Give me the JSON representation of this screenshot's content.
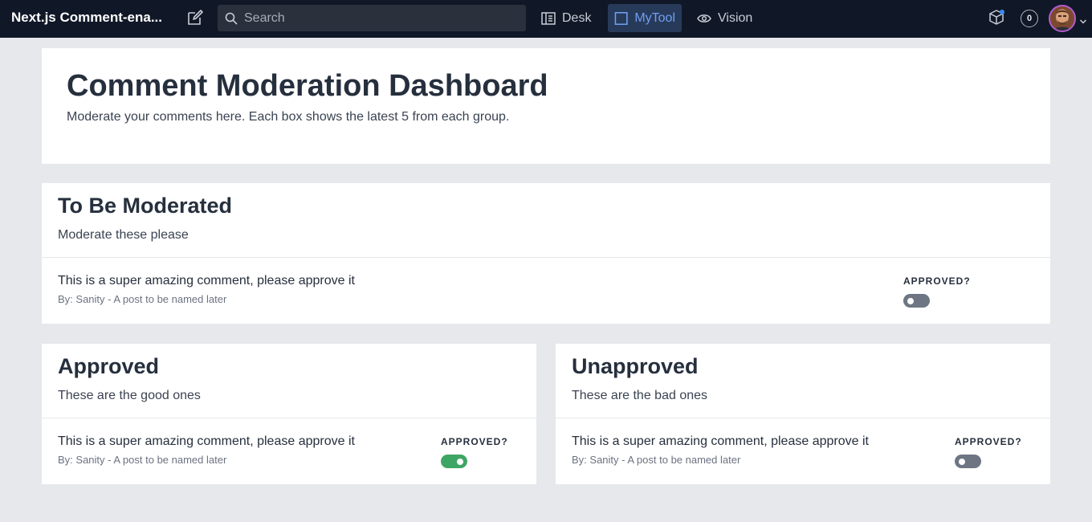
{
  "navbar": {
    "brand": "Next.js Comment-ena...",
    "search_placeholder": "Search",
    "tabs": [
      {
        "label": "Desk",
        "icon": "desk-icon"
      },
      {
        "label": "MyTool",
        "icon": "square-icon"
      },
      {
        "label": "Vision",
        "icon": "eye-icon"
      }
    ],
    "active_tab": "MyTool",
    "notification_count": "0",
    "accent_color": "#6ea0f0"
  },
  "intro": {
    "title": "Comment Moderation Dashboard",
    "subtitle": "Moderate your comments here. Each box shows the latest 5 from each group."
  },
  "sections": {
    "to_be_moderated": {
      "title": "To Be Moderated",
      "subtitle": "Moderate these please",
      "comments": [
        {
          "text": "This is a super amazing comment, please approve it",
          "meta": "By: Sanity - A post to be named later",
          "approved_label": "APPROVED?",
          "approved": false
        }
      ]
    },
    "approved": {
      "title": "Approved",
      "subtitle": "These are the good ones",
      "comments": [
        {
          "text": "This is a super amazing comment, please approve it",
          "meta": "By: Sanity - A post to be named later",
          "approved_label": "APPROVED?",
          "approved": true
        }
      ]
    },
    "unapproved": {
      "title": "Unapproved",
      "subtitle": "These are the bad ones",
      "comments": [
        {
          "text": "This is a super amazing comment, please approve it",
          "meta": "By: Sanity - A post to be named later",
          "approved_label": "APPROVED?",
          "approved": false
        }
      ]
    }
  },
  "colors": {
    "navbar_bg": "#101827",
    "toggle_on": "#3fa564",
    "toggle_off": "#6e7683"
  }
}
